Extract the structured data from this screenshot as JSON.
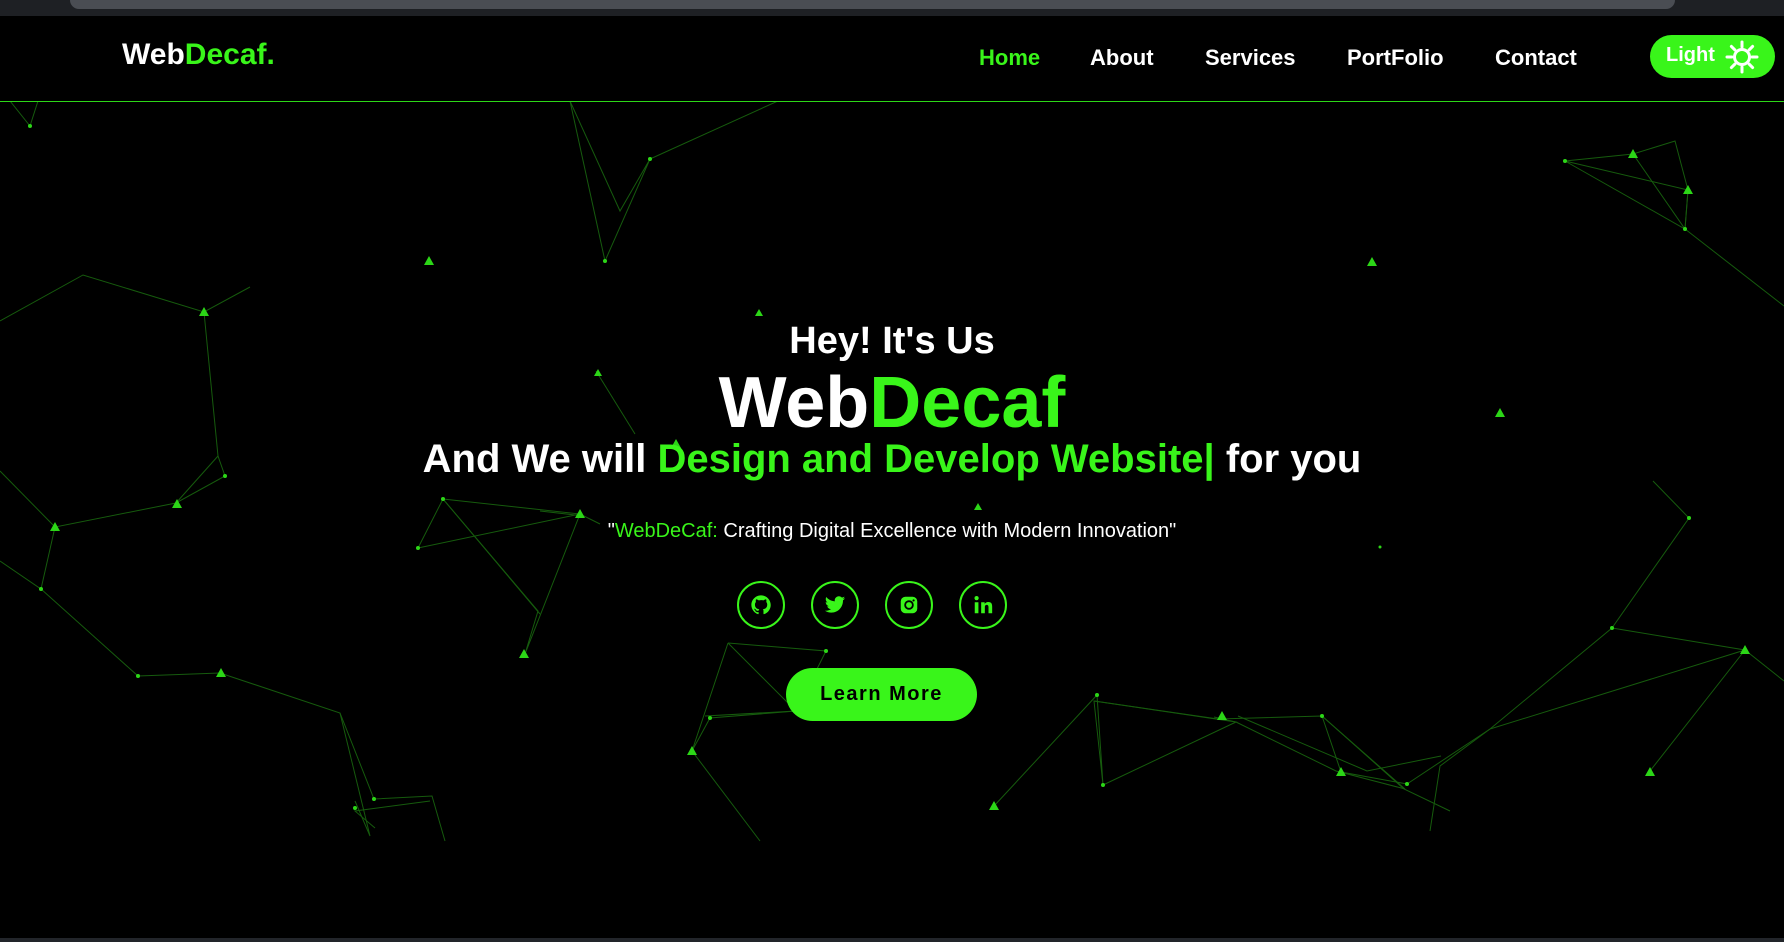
{
  "logo": {
    "primary": "Web",
    "accent": "Decaf."
  },
  "nav": {
    "items": [
      {
        "label": "Home",
        "active": true
      },
      {
        "label": "About",
        "active": false
      },
      {
        "label": "Services",
        "active": false
      },
      {
        "label": "PortFolio",
        "active": false
      },
      {
        "label": "Contact",
        "active": false
      }
    ]
  },
  "theme_toggle": {
    "label": "Light",
    "icon": "sun-icon"
  },
  "hero": {
    "greeting": "Hey! It's Us",
    "brand_primary": "Web",
    "brand_accent": "Decaf",
    "tagline_prefix": "And We will ",
    "tagline_accent": "Design and Develop Website|",
    "tagline_suffix": " for you",
    "quote_open": "\"",
    "quote_brand": "WebDeCaf:",
    "quote_text": " Crafting Digital Excellence with Modern Innovation\"",
    "cta_label": "Learn More"
  },
  "socials": [
    {
      "name": "github",
      "icon": "github-icon"
    },
    {
      "name": "twitter",
      "icon": "twitter-icon"
    },
    {
      "name": "instagram",
      "icon": "instagram-icon"
    },
    {
      "name": "linkedin",
      "icon": "linkedin-icon"
    }
  ],
  "colors": {
    "accent": "#39f51a",
    "background": "#000000",
    "text": "#ffffff",
    "network_line": "#1a6b10"
  }
}
